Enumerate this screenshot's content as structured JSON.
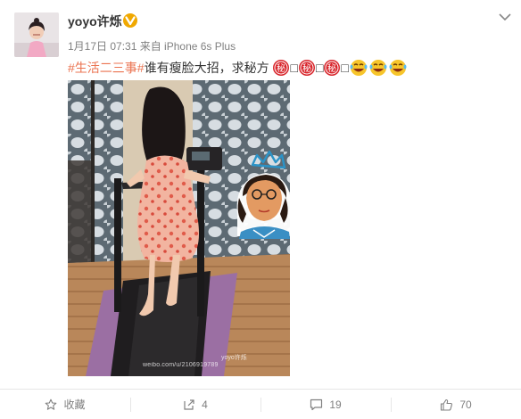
{
  "post": {
    "username": "yoyo许烁",
    "meta": "1月17日 07:31 来自 iPhone 6s Plus",
    "topic": "#生活二三事#",
    "text": "谁有瘦脸大招，求秘方",
    "emoji_mi": "秘",
    "box_char": "□"
  },
  "watermark": {
    "line1": "weibo.com/u/2106919789",
    "line2": "yoyo许烁"
  },
  "actions": {
    "favorite_label": "收藏",
    "repost_count": "4",
    "comment_count": "19",
    "like_count": "70"
  },
  "colors": {
    "topic": "#eb7350",
    "vip_badge": "#f0a800",
    "mi_emoji": "#d8262c",
    "laugh_emoji": "#f7c52b"
  }
}
